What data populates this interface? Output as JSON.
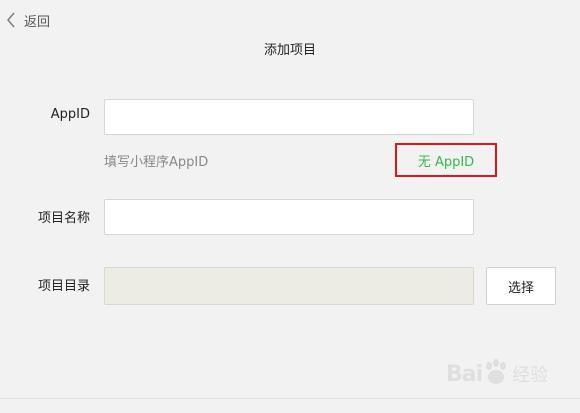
{
  "nav": {
    "back_label": "返回"
  },
  "page": {
    "title": "添加项目"
  },
  "form": {
    "appid": {
      "label": "AppID",
      "value": "",
      "hint": "填写小程序AppID",
      "no_appid_link": "无 AppID"
    },
    "project_name": {
      "label": "项目名称",
      "value": ""
    },
    "project_dir": {
      "label": "项目目录",
      "value": "",
      "select_button": "选择"
    }
  },
  "watermark": {
    "text_left": "Bai",
    "text_right": "经验"
  },
  "colors": {
    "background": "#f2f2f2",
    "link_green": "#3bb84a",
    "highlight_red": "#e0151b",
    "disabled_field": "#ecece4"
  },
  "icons": {
    "back": "chevron-left-icon",
    "watermark_logo": "paw-icon"
  }
}
